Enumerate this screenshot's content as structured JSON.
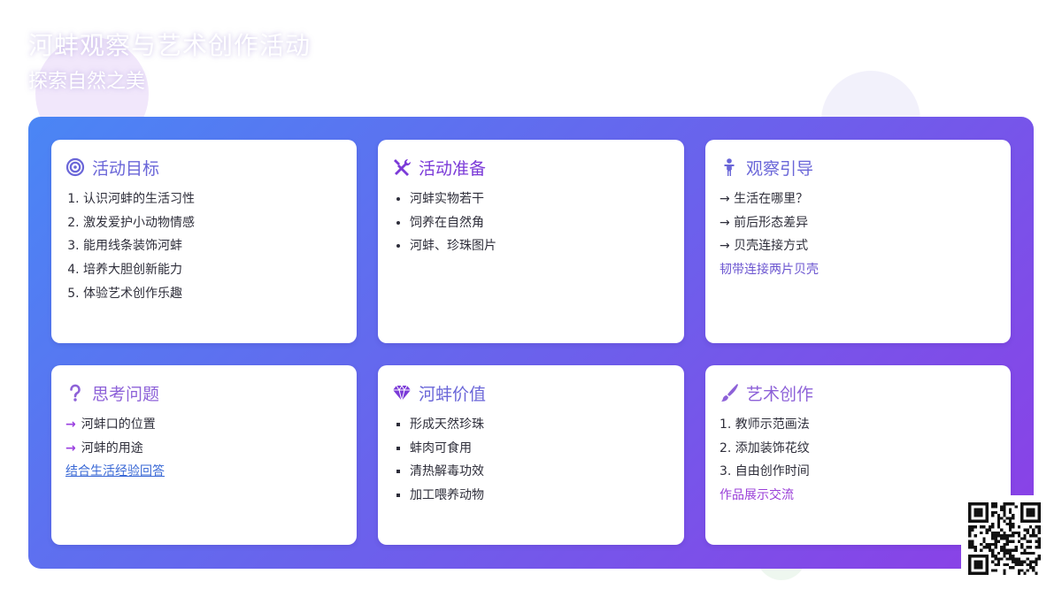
{
  "header": {
    "title": "河蚌观察与艺术创作活动",
    "subtitle": "探索自然之美"
  },
  "colors": {
    "panel_gradient_start": "#4a86f5",
    "panel_gradient_end": "#8c3fe6",
    "card_title": "#6a66d8",
    "accent_purple": "#9a3fe0",
    "link_blue": "#3a69d6"
  },
  "cards": [
    {
      "title": "活动目标",
      "icon": "bullseye-icon",
      "items": [
        "认识河蚌的生活习性",
        "激发爱护小动物情感",
        "能用线条装饰河蚌",
        "培养大胆创新能力",
        "体验艺术创作乐趣"
      ]
    },
    {
      "title": "活动准备",
      "icon": "tools-icon",
      "items": [
        "河蚌实物若干",
        "饲养在自然角",
        "河蚌、珍珠图片"
      ]
    },
    {
      "title": "观察引导",
      "icon": "child-icon",
      "items": [
        "→ 生活在哪里？",
        "→ 前后形态差异",
        "→ 贝壳连接方式"
      ],
      "note": "韧带连接两片贝壳"
    },
    {
      "title": "思考问题",
      "icon": "question-icon",
      "arrow": "→",
      "items": [
        "河蚌口的位置",
        "河蚌的用途"
      ],
      "note": "结合生活经验回答"
    },
    {
      "title": "河蚌价值",
      "icon": "gem-icon",
      "items": [
        "形成天然珍珠",
        "蚌肉可食用",
        "清热解毒功效",
        "加工喂养动物"
      ]
    },
    {
      "title": "艺术创作",
      "icon": "paint-brush-icon",
      "items": [
        "1. 教师示范画法",
        "2. 添加装饰花纹",
        "3. 自由创作时间"
      ],
      "note": "作品展示交流"
    }
  ],
  "qr": {
    "icon": "qr-code-icon"
  }
}
